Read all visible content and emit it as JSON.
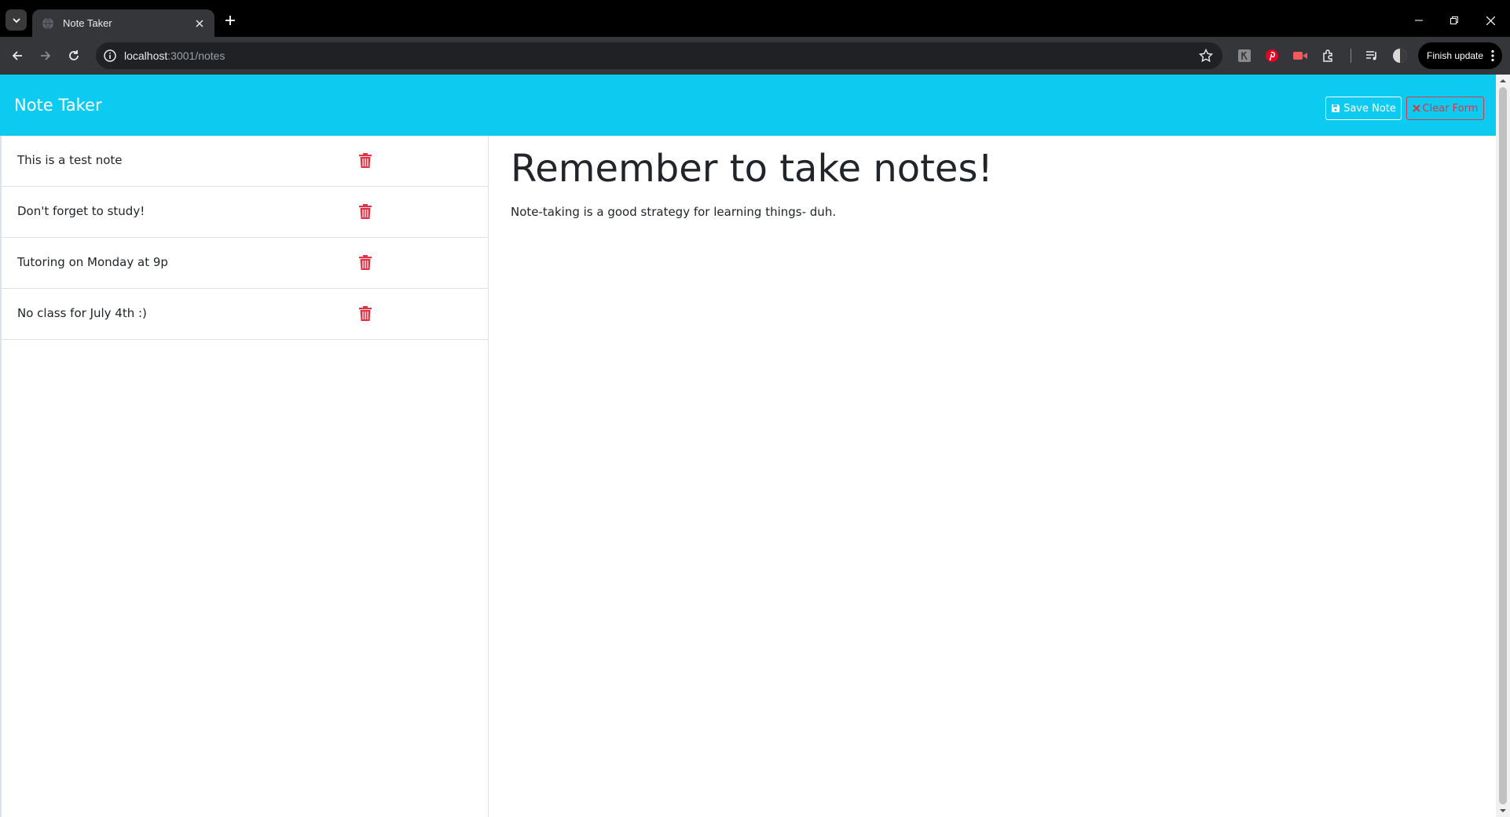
{
  "browser": {
    "tab_title": "Note Taker",
    "url_host": "localhost",
    "url_rest": ":3001/notes",
    "finish_update_label": "Finish update"
  },
  "app": {
    "brand": "Note Taker",
    "save_label": "Save Note",
    "clear_label": "Clear Form",
    "accent_color": "#0dcaf0",
    "danger_color": "#dc3545"
  },
  "notes": [
    {
      "title": "This is a test note"
    },
    {
      "title": "Don't forget to study!"
    },
    {
      "title": "Tutoring on Monday at 9p"
    },
    {
      "title": "No class for July 4th :)"
    }
  ],
  "active_note": {
    "title": "Remember to take notes!",
    "text": "Note-taking is a good strategy for learning things- duh."
  }
}
